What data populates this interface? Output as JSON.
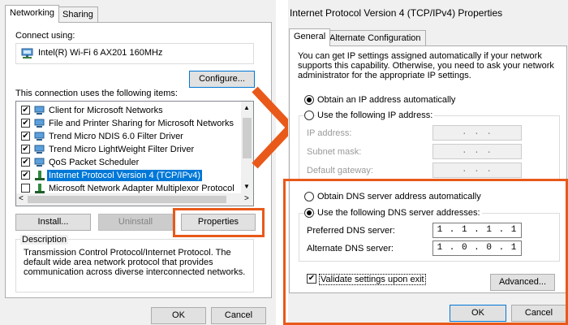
{
  "left": {
    "tabs": [
      "Networking",
      "Sharing"
    ],
    "connect_using_label": "Connect using:",
    "adapter_name": "Intel(R) Wi-Fi 6 AX201 160MHz",
    "configure_label": "Configure...",
    "items_label": "This connection uses the following items:",
    "items": [
      {
        "label": "Client for Microsoft Networks",
        "checked": true
      },
      {
        "label": "File and Printer Sharing for Microsoft Networks",
        "checked": true
      },
      {
        "label": "Trend Micro NDIS 6.0 Filter Driver",
        "checked": true
      },
      {
        "label": "Trend Micro LightWeight Filter Driver",
        "checked": true
      },
      {
        "label": "QoS Packet Scheduler",
        "checked": true
      },
      {
        "label": "Internet Protocol Version 4 (TCP/IPv4)",
        "checked": true,
        "selected": true
      },
      {
        "label": "Microsoft Network Adapter Multiplexor Protocol",
        "checked": false
      }
    ],
    "install_label": "Install...",
    "uninstall_label": "Uninstall",
    "properties_label": "Properties",
    "description_title": "Description",
    "description_text": "Transmission Control Protocol/Internet Protocol. The default wide area network protocol that provides communication across diverse interconnected networks.",
    "ok_label": "OK",
    "cancel_label": "Cancel"
  },
  "right": {
    "title": "Internet Protocol Version 4 (TCP/IPv4) Properties",
    "tabs": [
      "General",
      "Alternate Configuration"
    ],
    "intro_text": "You can get IP settings assigned automatically if your network supports this capability. Otherwise, you need to ask your network administrator for the appropriate IP settings.",
    "obtain_ip_auto": "Obtain an IP address automatically",
    "use_following_ip": "Use the following IP address:",
    "ip_address_label": "IP address:",
    "subnet_mask_label": "Subnet mask:",
    "default_gateway_label": "Default gateway:",
    "empty_ip": ".     .     .",
    "obtain_dns_auto": "Obtain DNS server address automatically",
    "use_following_dns": "Use the following DNS server addresses:",
    "preferred_dns_label": "Preferred DNS server:",
    "preferred_dns_value": "1 . 1 . 1 . 1",
    "alternate_dns_label": "Alternate DNS server:",
    "alternate_dns_value": "1 . 0 . 0 . 1",
    "validate_label": "Validate settings upon exit",
    "validate_checked": true,
    "advanced_label": "Advanced...",
    "ok_label": "OK",
    "cancel_label": "Cancel"
  },
  "colors": {
    "highlight_orange": "#e8591a",
    "selection_blue": "#0078d7",
    "dialog_bg": "#f0f0f0"
  },
  "icons": [
    "network-adapter-icon",
    "network-client-icon",
    "protocol-icon",
    "checkmark-icon",
    "scroll-arrow-icon",
    "pointer-arrow-icon"
  ]
}
